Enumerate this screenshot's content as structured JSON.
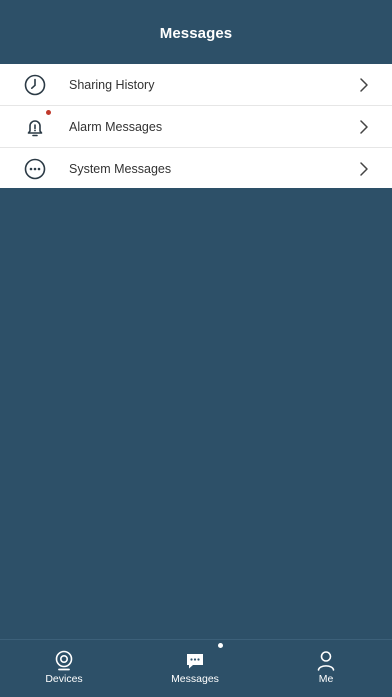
{
  "header": {
    "title": "Messages"
  },
  "list": {
    "items": [
      {
        "label": "Sharing History",
        "icon": "clock-icon"
      },
      {
        "label": "Alarm Messages",
        "icon": "bell-icon",
        "badge_color": "#c0392b"
      },
      {
        "label": "System Messages",
        "icon": "chat-bubble-icon"
      }
    ]
  },
  "tabbar": {
    "tabs": [
      {
        "label": "Devices",
        "icon": "camera-icon"
      },
      {
        "label": "Messages",
        "icon": "message-icon",
        "active": true
      },
      {
        "label": "Me",
        "icon": "person-icon"
      }
    ]
  },
  "colors": {
    "background": "#2d5068",
    "list_background": "#ffffff",
    "text": "#333333",
    "badge": "#c0392b"
  }
}
